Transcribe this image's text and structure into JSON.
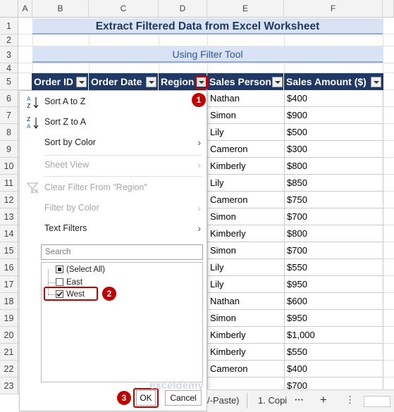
{
  "columns": [
    "A",
    "B",
    "C",
    "D",
    "E",
    "F"
  ],
  "rows": [
    "1",
    "2",
    "3",
    "4",
    "5",
    "6",
    "7",
    "8",
    "9",
    "10",
    "11",
    "12",
    "13",
    "14",
    "15",
    "16",
    "17",
    "18",
    "19",
    "20",
    "21",
    "22",
    "23"
  ],
  "title": "Extract Filtered Data from Excel Worksheet",
  "subtitle": "Using Filter Tool",
  "headers": {
    "order_id": "Order ID",
    "order_date": "Order Date",
    "region": "Region",
    "sales_person": "Sales Person",
    "sales_amount": "Sales Amount ($)"
  },
  "table_rows": [
    {
      "person": "Nathan",
      "amount": "$400"
    },
    {
      "person": "Simon",
      "amount": "$900"
    },
    {
      "person": "Lily",
      "amount": "$500"
    },
    {
      "person": "Cameron",
      "amount": "$300"
    },
    {
      "person": "Kimberly",
      "amount": "$800"
    },
    {
      "person": "Lily",
      "amount": "$850"
    },
    {
      "person": "Cameron",
      "amount": "$750"
    },
    {
      "person": "Simon",
      "amount": "$700"
    },
    {
      "person": "Kimberly",
      "amount": "$800"
    },
    {
      "person": "Simon",
      "amount": "$700"
    },
    {
      "person": "Lily",
      "amount": "$550"
    },
    {
      "person": "Lily",
      "amount": "$950"
    },
    {
      "person": "Nathan",
      "amount": "$600"
    },
    {
      "person": "Simon",
      "amount": "$950"
    },
    {
      "person": "Kimberly",
      "amount": "$1,000"
    },
    {
      "person": "Kimberly",
      "amount": "$550"
    },
    {
      "person": "Cameron",
      "amount": "$400"
    },
    {
      "person": "",
      "amount": "$700"
    }
  ],
  "menu": {
    "sort_az": "Sort A to Z",
    "sort_za": "Sort Z to A",
    "sort_by_color": "Sort by Color",
    "sheet_view": "Sheet View",
    "clear_filter": "Clear Filter From \"Region\"",
    "filter_by_color": "Filter by Color",
    "text_filters": "Text Filters",
    "search_placeholder": "Search",
    "items": [
      {
        "label": "(Select All)",
        "state": "partial"
      },
      {
        "label": "East",
        "state": "unchecked"
      },
      {
        "label": "West",
        "state": "checked"
      }
    ],
    "ok": "OK",
    "cancel": "Cancel"
  },
  "badges": [
    "1",
    "2",
    "3"
  ],
  "sheet_tabs": {
    "partial_tab": "/-Paste)",
    "tab": "1. Copi",
    "more": "···",
    "add": "+",
    "nav": "⋮"
  },
  "watermark": "exceldemy",
  "colors": {
    "header_bg": "#203864",
    "banner_bg": "#dae3f3",
    "badge": "#c00000"
  }
}
